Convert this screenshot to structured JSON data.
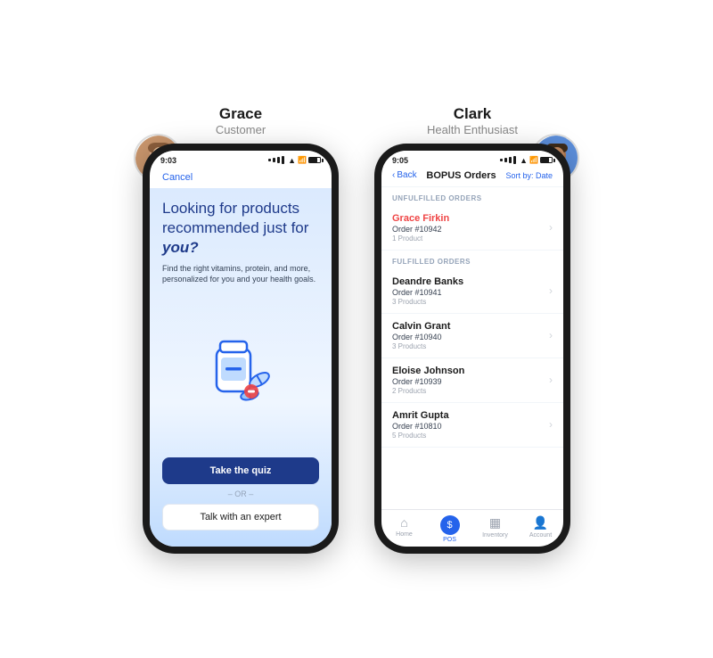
{
  "grace": {
    "name": "Grace",
    "role": "Customer",
    "time": "9:03",
    "cancel_label": "Cancel",
    "headline_part1": "Looking for products recommended just for ",
    "headline_bold": "you?",
    "subtext": "Find the right vitamins, protein, and more, personalized for you and your health goals.",
    "quiz_button": "Take the quiz",
    "or_text": "– OR –",
    "expert_button": "Talk with an expert"
  },
  "clark": {
    "name": "Clark",
    "role": "Health Enthusiast",
    "time": "9:05",
    "back_label": "Back",
    "page_title": "BOPUS Orders",
    "sort_label": "Sort by: Date",
    "unfulfilled_section": "UNFULFILLED ORDERS",
    "fulfilled_section": "FULFILLED ORDERS",
    "orders": [
      {
        "name": "Grace Firkin",
        "order": "Order #10942",
        "products": "1 Product",
        "unfulfilled": true
      },
      {
        "name": "Deandre Banks",
        "order": "Order #10941",
        "products": "3 Products",
        "unfulfilled": false
      },
      {
        "name": "Calvin Grant",
        "order": "Order #10940",
        "products": "3 Products",
        "unfulfilled": false
      },
      {
        "name": "Eloise Johnson",
        "order": "Order #10939",
        "products": "2 Products",
        "unfulfilled": false
      },
      {
        "name": "Amrit Gupta",
        "order": "Order #10810",
        "products": "5 Products",
        "unfulfilled": false
      }
    ],
    "nav": [
      {
        "label": "Home",
        "icon": "🏠",
        "active": false
      },
      {
        "label": "POS",
        "icon": "$",
        "active": true
      },
      {
        "label": "Inventory",
        "icon": "📦",
        "active": false
      },
      {
        "label": "Account",
        "icon": "👤",
        "active": false
      }
    ]
  }
}
